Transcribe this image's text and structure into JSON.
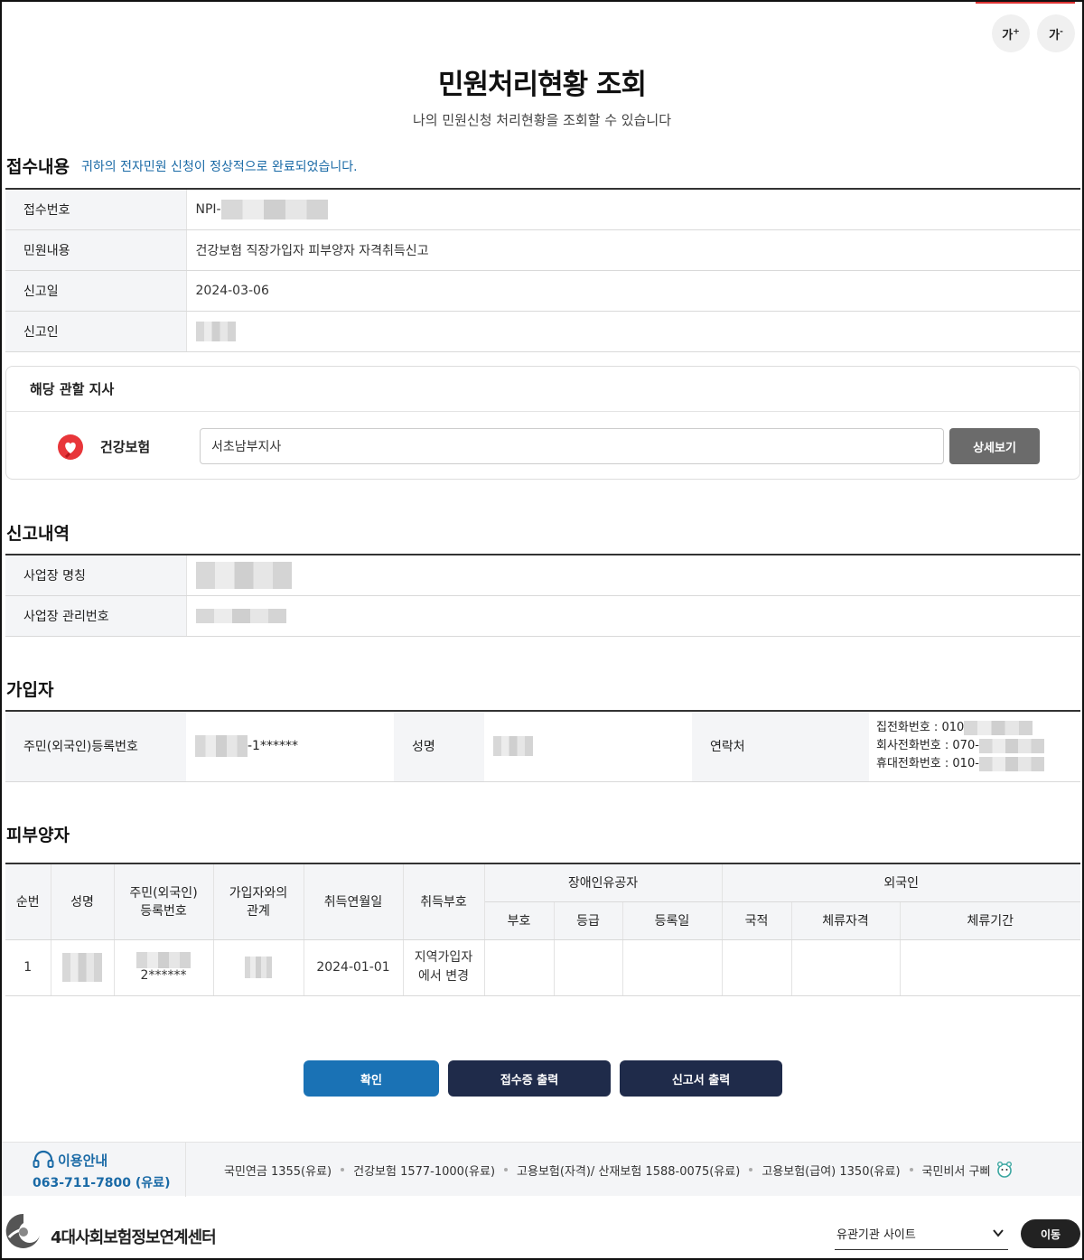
{
  "font_controls": {
    "increase": "가",
    "decrease": "가",
    "increase_sup": "+",
    "decrease_sup": "-"
  },
  "page": {
    "title": "민원처리현황 조회",
    "subtitle": "나의 민원신청 처리현황을 조회할 수 있습니다"
  },
  "receipt": {
    "section_title": "접수내용",
    "notice": "귀하의 전자민원 신청이 정상적으로 완료되었습니다.",
    "rows": [
      {
        "label": "접수번호",
        "value": "NPI-"
      },
      {
        "label": "민원내용",
        "value": "건강보험 직장가입자 피부양자 자격취득신고"
      },
      {
        "label": "신고일",
        "value": "2024-03-06"
      },
      {
        "label": "신고인",
        "value": ""
      }
    ]
  },
  "branch": {
    "title": "해당 관할 지사",
    "insurer": "건강보험",
    "office": "서초남부지사",
    "detail_button": "상세보기"
  },
  "report": {
    "section_title": "신고내역",
    "rows": [
      {
        "label": "사업장 명칭",
        "value": ""
      },
      {
        "label": "사업장 관리번호",
        "value": ""
      }
    ]
  },
  "subscriber": {
    "section_title": "가입자",
    "id_label": "주민(외국인)등록번호",
    "id_value": "-1******",
    "name_label": "성명",
    "contact_label": "연락처",
    "phones": [
      "집전화번호 : 010",
      "회사전화번호 : 070-",
      "휴대전화번호 : 010-"
    ]
  },
  "dependents": {
    "section_title": "피부양자",
    "headers": {
      "seq": "순번",
      "name": "성명",
      "id": "주민(외국인)\n등록번호",
      "relation": "가입자와의\n관계",
      "acq_date": "취득연월일",
      "acq_code": "취득부호",
      "disabled_group": "장애인유공자",
      "disabled_code": "부호",
      "disabled_grade": "등급",
      "disabled_reg": "등록일",
      "foreign_group": "외국인",
      "nationality": "국적",
      "stay_status": "체류자격",
      "stay_period": "체류기간"
    },
    "rows": [
      {
        "seq": "1",
        "id_suffix": "2******",
        "acq_date": "2024-01-01",
        "acq_code": "지역가입자\n에서 변경"
      }
    ]
  },
  "actions": {
    "confirm": "확인",
    "print_receipt": "접수증 출력",
    "print_report": "신고서 출력"
  },
  "footer": {
    "contact_title": "이용안내",
    "contact_phone": "063-711-7800 (유료)",
    "hotlines": [
      "국민연금 1355(유료)",
      "건강보험 1577-1000(유료)",
      "고용보험(자격)/ 산재보험 1588-0075(유료)",
      "고용보험(급여) 1350(유료)",
      "국민비서 구삐"
    ],
    "org_name": "4대사회보험정보연계센터",
    "site_select": "유관기관 사이트",
    "go_button": "이동"
  },
  "colors": {
    "accent": "#1a72b5",
    "navy": "#1f2b4a",
    "notice": "#1a6aa6",
    "heart": "#e8363a"
  }
}
